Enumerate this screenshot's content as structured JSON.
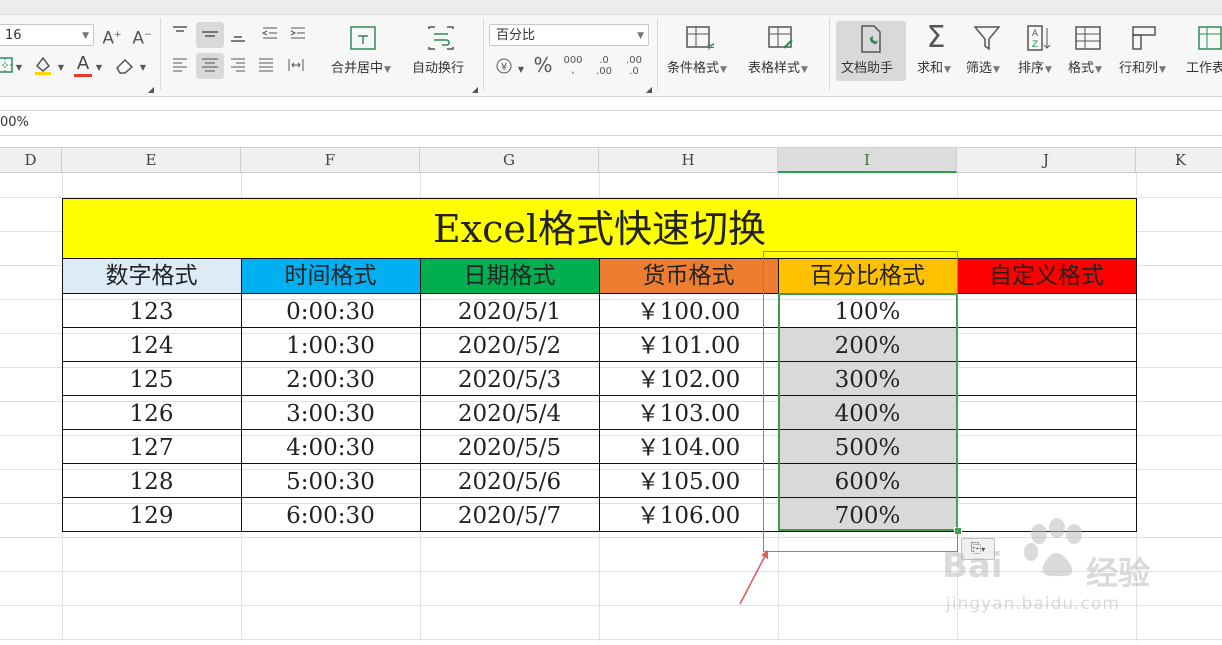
{
  "ribbon": {
    "font_size": "16",
    "number_format": "百分比",
    "font_grow_icon": "A⁺",
    "font_shrink_icon": "A⁻",
    "font_color_letter": "A",
    "merge_label": "合并居中",
    "wrap_label": "自动换行",
    "cond_format_label": "条件格式",
    "table_style_label": "表格样式",
    "doc_helper_label": "文档助手",
    "sum_label": "求和",
    "filter_label": "筛选",
    "sort_label": "排序",
    "format_label": "格式",
    "rowcol_label": "行和列",
    "worksheet_label": "工作表",
    "percent_symbol": "%",
    "thousands_symbol": "000",
    "inc_decimal": ".0 .00",
    "dec_decimal": ".00 .0"
  },
  "formula_bar": {
    "value": "00%"
  },
  "columns": [
    "D",
    "E",
    "F",
    "G",
    "H",
    "I",
    "J",
    "K"
  ],
  "selected_column": "I",
  "table": {
    "title": "Excel格式快速切换",
    "headers": [
      {
        "text": "数字格式",
        "color": "#ddebf7"
      },
      {
        "text": "时间格式",
        "color": "#00b0f0"
      },
      {
        "text": "日期格式",
        "color": "#00b050"
      },
      {
        "text": "货币格式",
        "color": "#ed7d31"
      },
      {
        "text": "百分比格式",
        "color": "#ffc000"
      },
      {
        "text": "自定义格式",
        "color": "#ff0000"
      }
    ],
    "rows": [
      [
        "123",
        "0:00:30",
        "2020/5/1",
        "￥100.00",
        "100%",
        ""
      ],
      [
        "124",
        "1:00:30",
        "2020/5/2",
        "￥101.00",
        "200%",
        ""
      ],
      [
        "125",
        "2:00:30",
        "2020/5/3",
        "￥102.00",
        "300%",
        ""
      ],
      [
        "126",
        "3:00:30",
        "2020/5/4",
        "￥103.00",
        "400%",
        ""
      ],
      [
        "127",
        "4:00:30",
        "2020/5/5",
        "￥104.00",
        "500%",
        ""
      ],
      [
        "128",
        "5:00:30",
        "2020/5/6",
        "￥105.00",
        "600%",
        ""
      ],
      [
        "129",
        "6:00:30",
        "2020/5/7",
        "￥106.00",
        "700%",
        ""
      ]
    ]
  },
  "watermark": {
    "brand": "Bai",
    "brand_cn": "经验",
    "url": "jingyan.baidu.com"
  },
  "colors": {
    "accent": "#3c9c4c",
    "annotation": "#e06060",
    "title_bg": "#ffff00"
  }
}
